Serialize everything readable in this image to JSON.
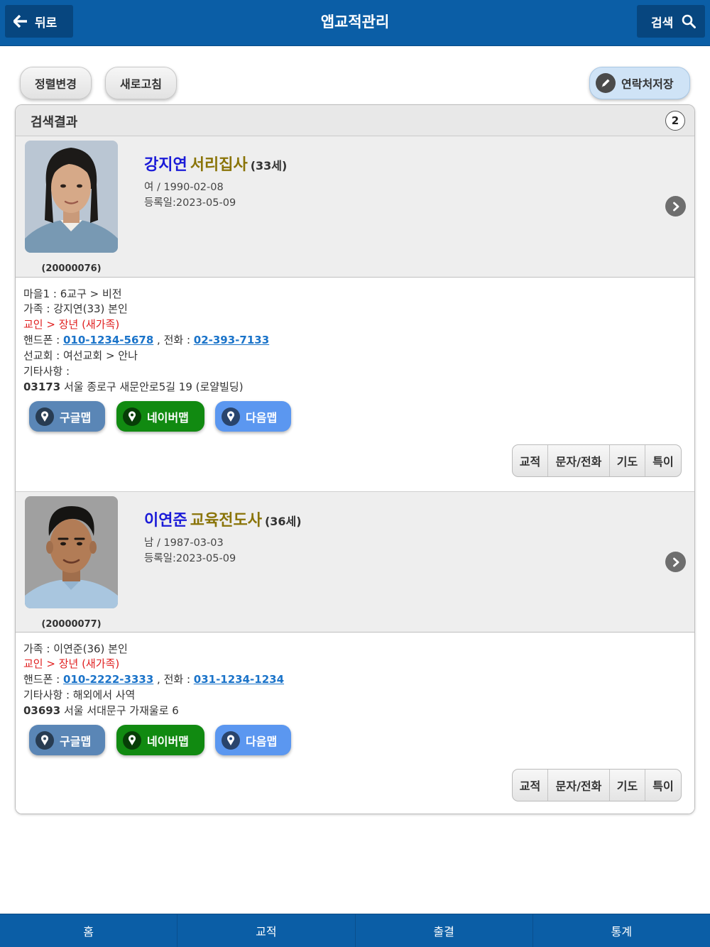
{
  "header": {
    "back_label": "뒤로",
    "title": "앱교적관리",
    "search_label": "검색"
  },
  "toolbar": {
    "sort_label": "정렬변경",
    "refresh_label": "새로고침",
    "save_contacts_label": "연락처저장"
  },
  "results": {
    "title": "검색결과",
    "count": "2",
    "people": [
      {
        "id_label": "(20000076)",
        "name": "강지연",
        "title": "서리집사",
        "age": "(33세)",
        "gender_birth": "여 / 1990-02-08",
        "registered": "등록일:2023-05-09",
        "village": "마을1 : 6교구 > 비전",
        "family": "가족 : 강지연(33) 본인",
        "status": "교인 > 장년 (새가족)",
        "phone_label": "핸드폰 : ",
        "phone": "010-1234-5678",
        "tel_label": " , 전화 : ",
        "tel": "02-393-7133",
        "prev_church": "선교회 : 여선교회 > 안나",
        "etc": "기타사항 :",
        "postcode": "03173",
        "address": " 서울 종로구 새문안로5길 19 (로얄빌딩)"
      },
      {
        "id_label": "(20000077)",
        "name": "이연준",
        "title": "교육전도사",
        "age": "(36세)",
        "gender_birth": "남 / 1987-03-03",
        "registered": "등록일:2023-05-09",
        "family": "가족 : 이연준(36) 본인",
        "status": "교인 > 장년 (새가족)",
        "phone_label": "핸드폰 : ",
        "phone": "010-2222-3333",
        "tel_label": " , 전화 : ",
        "tel": "031-1234-1234",
        "etc": "기타사항 : 해외에서 사역",
        "postcode": "03693",
        "address": " 서울 서대문구 가재울로 6"
      }
    ]
  },
  "maps": {
    "google": "구글맵",
    "naver": "네이버맵",
    "daum": "다음맵"
  },
  "actions": {
    "records": "교적",
    "sms_call": "문자/전화",
    "prayer": "기도",
    "special": "특이"
  },
  "footer": {
    "tabs": [
      "홈",
      "교적",
      "출결",
      "통계"
    ]
  },
  "colors": {
    "header_bg": "#0b5ea6",
    "name": "#1a1ad8",
    "title": "#8a7408",
    "status": "#e02020",
    "link": "#1a73c9"
  },
  "icons": {
    "back": "arrow-left-icon",
    "search": "magnifier-icon",
    "save": "pencil-icon",
    "detail": "chevron-right-icon",
    "map": "map-pin-icon"
  }
}
